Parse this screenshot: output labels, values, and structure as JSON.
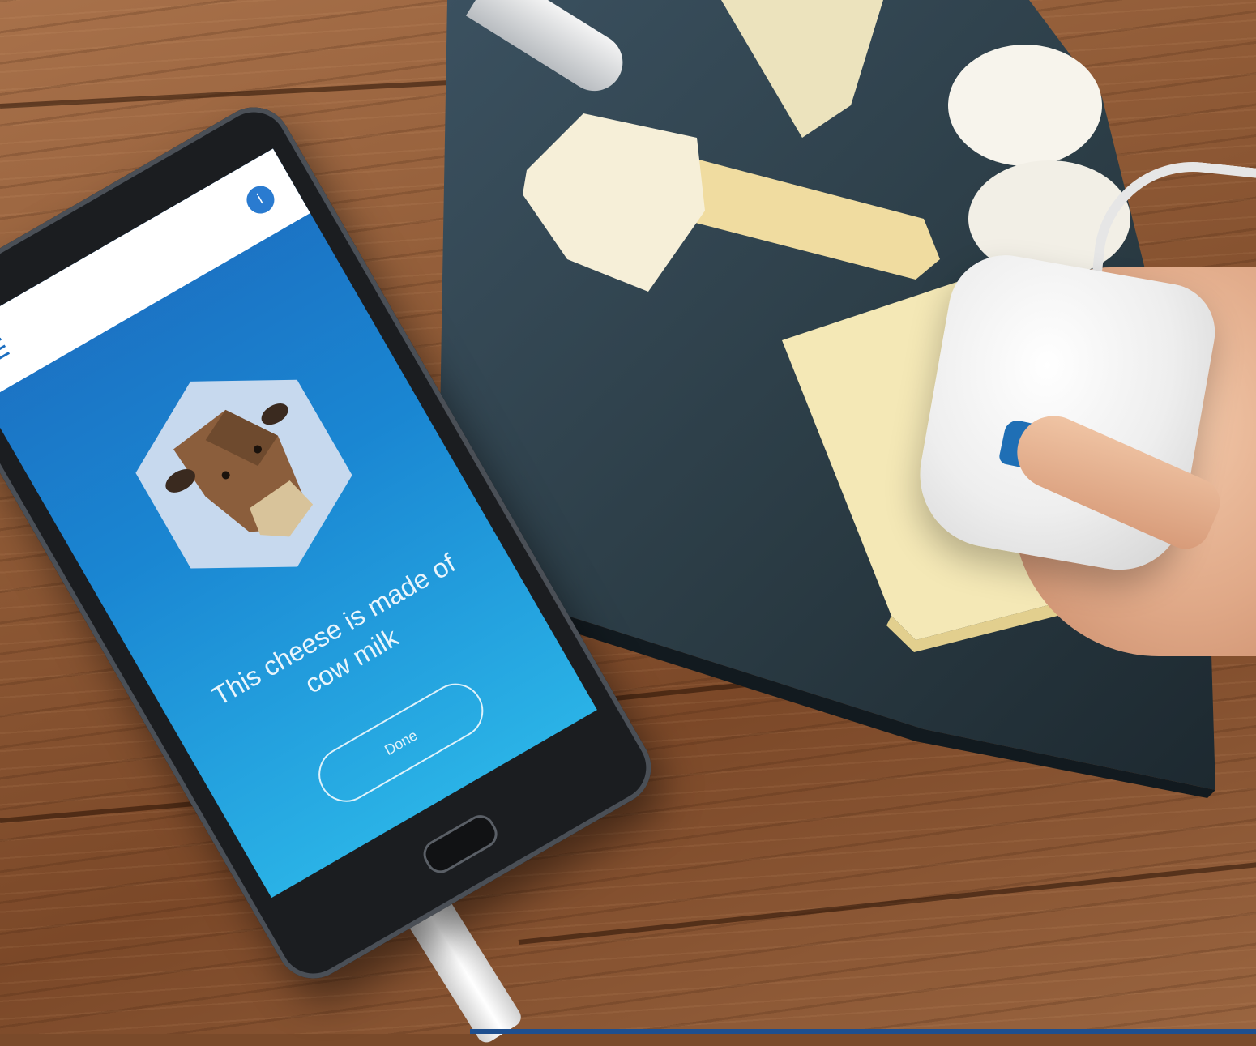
{
  "screen": {
    "info_badge": "i",
    "result_text": "This cheese is made of cow milk",
    "done_label": "Done"
  },
  "colors": {
    "screen_top": "#1c6ec0",
    "screen_bottom": "#2ab2e6",
    "slate": "#2b3c45",
    "device_button": "#1f6fb5"
  },
  "icons": {
    "menu": "menu-icon",
    "info": "info-icon",
    "animal": "cow-icon"
  }
}
